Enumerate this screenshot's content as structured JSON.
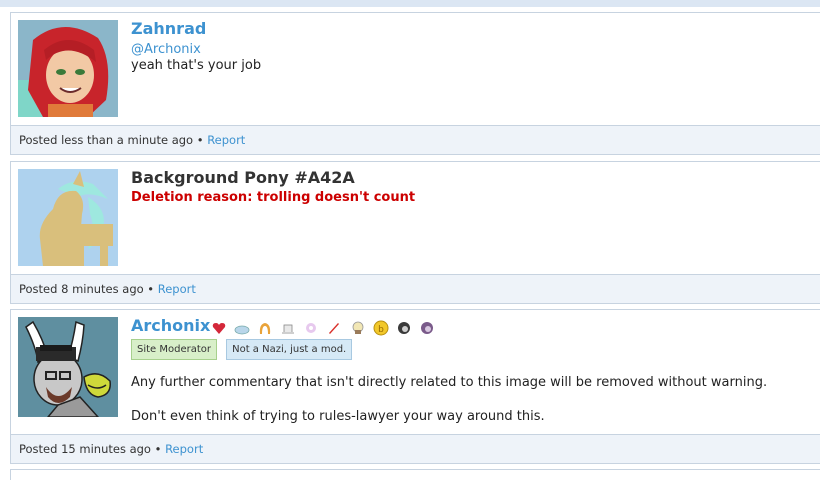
{
  "comments": [
    {
      "username": "Zahnrad",
      "mention": "@Archonix",
      "text": "yeah that's your job",
      "footer_text": "Posted less than a minute ago •",
      "report_label": "Report"
    },
    {
      "username": "Background Pony #A42A",
      "deletion_reason": "Deletion reason: trolling doesn't count",
      "footer_text": "Posted 8 minutes ago •",
      "report_label": "Report"
    },
    {
      "username": "Archonix",
      "badge_icons": [
        "heart-gem-icon",
        "cloud-icon",
        "horseshoe-icon",
        "hat-icon",
        "flower-icon",
        "brush-icon",
        "muffin-icon",
        "bit-coin-icon",
        "pony-icon",
        "pony-icon"
      ],
      "tags": [
        "Site Moderator",
        "Not a Nazi, just a mod."
      ],
      "paragraphs": [
        "Any further commentary that isn't directly related to this image will be removed without warning.",
        "Don't even think of trying to rules-lawyer your way around this."
      ],
      "footer_text": "Posted 15 minutes ago •",
      "report_label": "Report"
    }
  ],
  "colors": {
    "link": "#3d92d0",
    "deletion": "#cc0000",
    "border": "#c7d3e0",
    "footer_bg": "#eef3f9"
  }
}
